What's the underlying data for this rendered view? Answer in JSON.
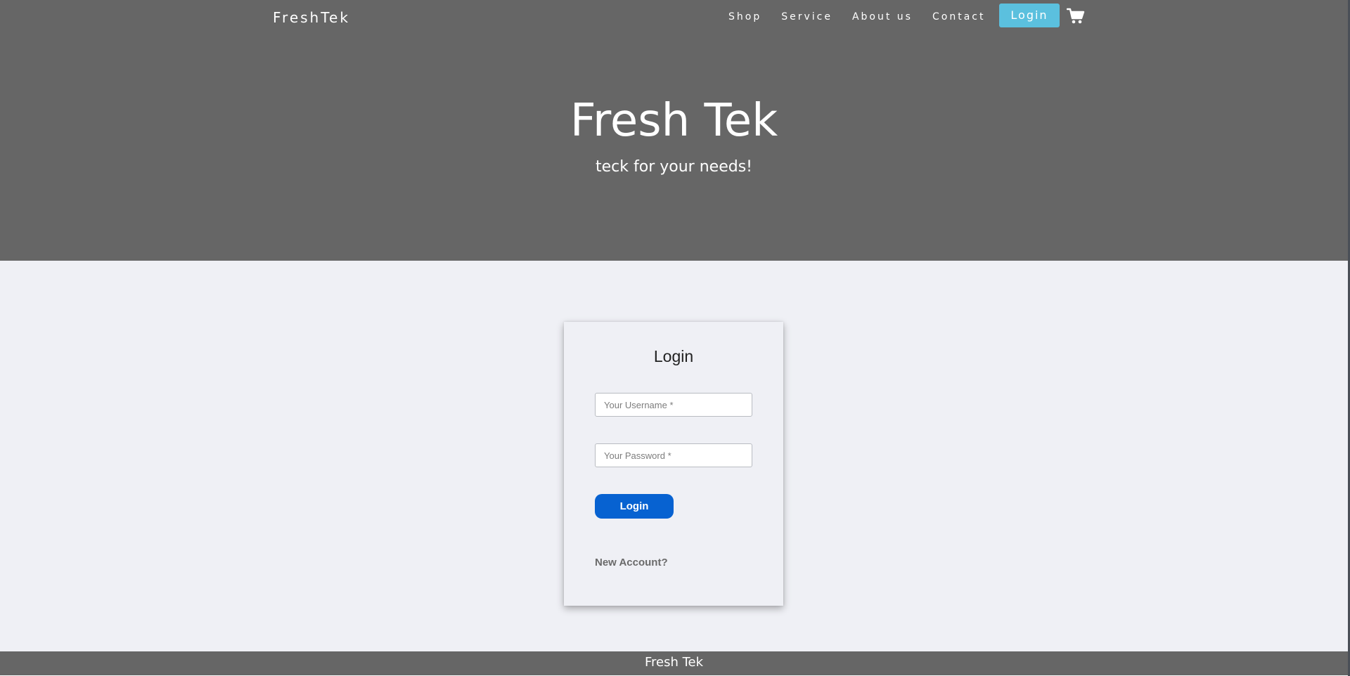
{
  "header": {
    "brand": "FreshTek",
    "nav": [
      "Shop",
      "Service",
      "About us",
      "Contact"
    ],
    "login_label": "Login",
    "cart_icon": "shopping-cart-icon"
  },
  "hero": {
    "title": "Fresh Tek",
    "subtitle": "teck for your needs!"
  },
  "login_form": {
    "title": "Login",
    "username_placeholder": "Your Username *",
    "password_placeholder": "Your Password *",
    "submit_label": "Login",
    "new_account_label": "New Account?"
  },
  "footer": {
    "text": "Fresh Tek"
  },
  "colors": {
    "header_bg": "#666666",
    "page_bg": "#eff0f5",
    "nav_login_bg": "#5bc0de",
    "submit_bg": "#0762d1"
  }
}
